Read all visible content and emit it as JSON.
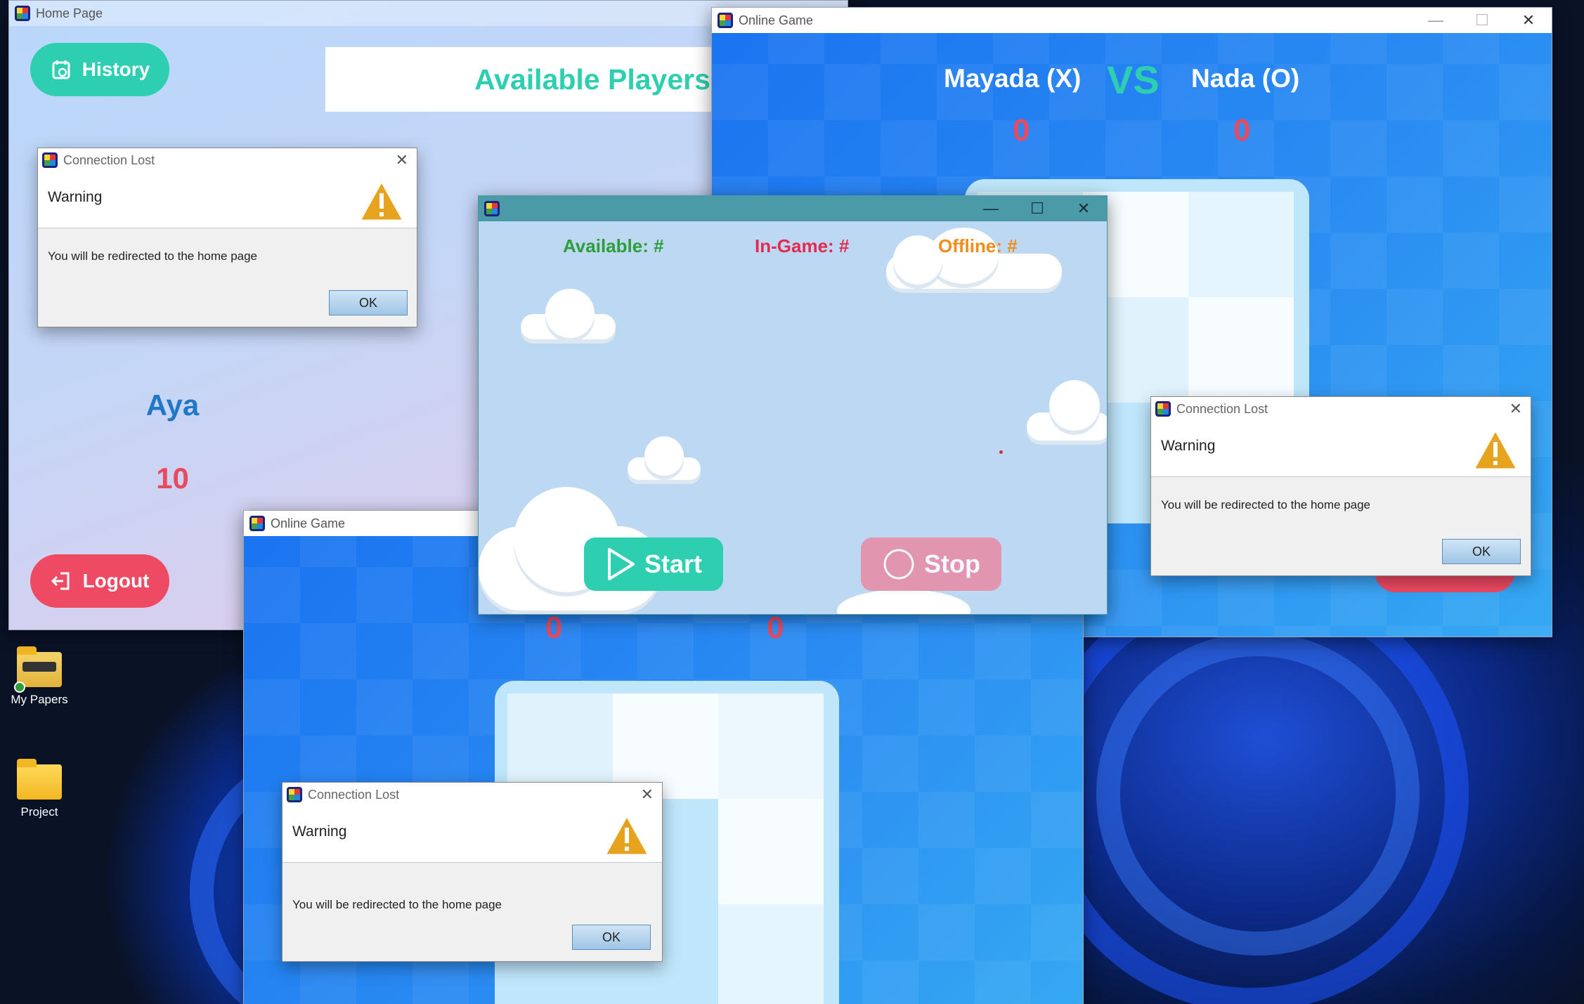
{
  "desktop": {
    "icons": [
      {
        "label": "My Papers",
        "icon": "folder-synced-icon"
      },
      {
        "label": "Project",
        "icon": "folder-icon"
      }
    ]
  },
  "home_window": {
    "title": "Home Page",
    "history_label": "History",
    "available_players_label": "Available Players",
    "player_name": "Aya",
    "player_score": "10",
    "logout_label": "Logout"
  },
  "game_window_right": {
    "title": "Online Game",
    "player_x": "Mayada (X)",
    "vs": "VS",
    "player_o": "Nada (O)",
    "score_x": "0",
    "score_o": "0"
  },
  "game_window_bottom": {
    "title": "Online Game",
    "score_left": "0",
    "score_right": "0"
  },
  "server_window": {
    "title": "",
    "available_label": "Available: #",
    "in_game_label": "In-Game: #",
    "offline_label": "Offline: #",
    "start_label": "Start",
    "stop_label": "Stop"
  },
  "dialogs": [
    {
      "title": "Connection Lost",
      "header": "Warning",
      "message": "You will be redirected to the home page",
      "ok": "OK"
    },
    {
      "title": "Connection Lost",
      "header": "Warning",
      "message": "You will be redirected to the home page",
      "ok": "OK"
    },
    {
      "title": "Connection Lost",
      "header": "Warning",
      "message": "You will be redirected to the home page",
      "ok": "OK"
    }
  ],
  "colors": {
    "teal": "#2ecfb1",
    "red": "#ef4a63",
    "score_red": "#e84a5f",
    "name_blue": "#1f78c8",
    "available_green": "#2e9e3a",
    "ingame_red": "#e8294f",
    "offline_orange": "#f28c1a",
    "warning_amber": "#e8a31e"
  }
}
